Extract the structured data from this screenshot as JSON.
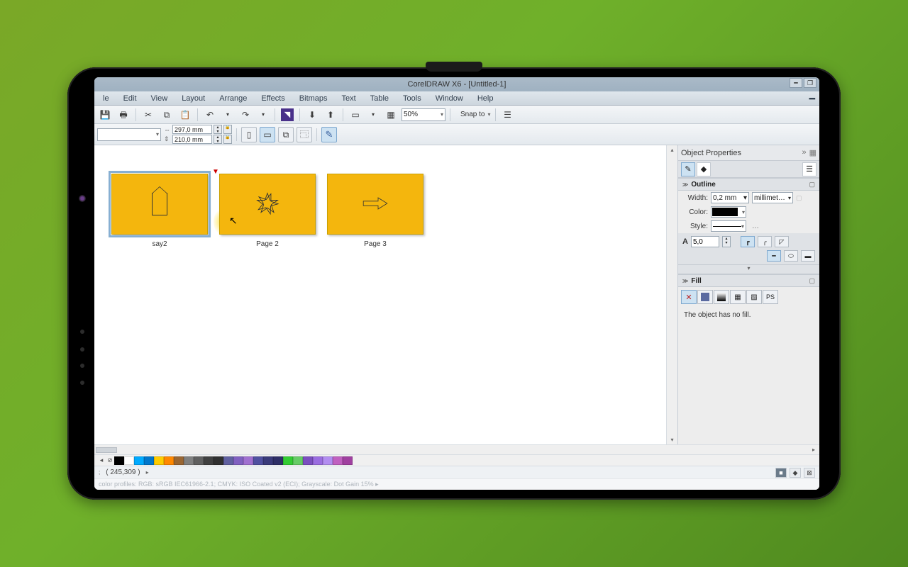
{
  "title": "CorelDRAW X6 - [Untitled-1]",
  "menu": [
    "le",
    "Edit",
    "View",
    "Layout",
    "Arrange",
    "Effects",
    "Bitmaps",
    "Text",
    "Table",
    "Tools",
    "Window",
    "Help"
  ],
  "toolbar1": {
    "zoom": "50%",
    "snap_label": "Snap to"
  },
  "toolbar2": {
    "width": "297,0 mm",
    "height": "210,0 mm"
  },
  "thumbs": [
    {
      "name": "say2"
    },
    {
      "name": "Page  2"
    },
    {
      "name": "Page  3"
    }
  ],
  "docker": {
    "title": "Object Properties",
    "outline": {
      "section": "Outline",
      "width_label": "Width:",
      "width_value": "0,2 mm",
      "units": "millimet…",
      "color_label": "Color:",
      "style_label": "Style:",
      "miter_value": "5,0"
    },
    "fill": {
      "section": "Fill",
      "message": "The object has no fill."
    }
  },
  "status": {
    "coords": "( 245,309 )"
  },
  "profiles": "color profiles: RGB: sRGB IEC61966-2.1; CMYK: ISO Coated v2 (ECI); Grayscale: Dot Gain 15%  ▸",
  "palette_colors": [
    "#000000",
    "#ffffff",
    "#00aaff",
    "#0077cc",
    "#ffcc00",
    "#ff8800",
    "#996633",
    "#808080",
    "#606060",
    "#404040",
    "#303030",
    "#6060a0",
    "#8060c0",
    "#a070d0",
    "#5050a0",
    "#3a3a7a",
    "#2e2e66",
    "#33cc33",
    "#66cc66",
    "#7b4fc0",
    "#9a6de0",
    "#b28df0",
    "#c060c0",
    "#a040a0"
  ]
}
